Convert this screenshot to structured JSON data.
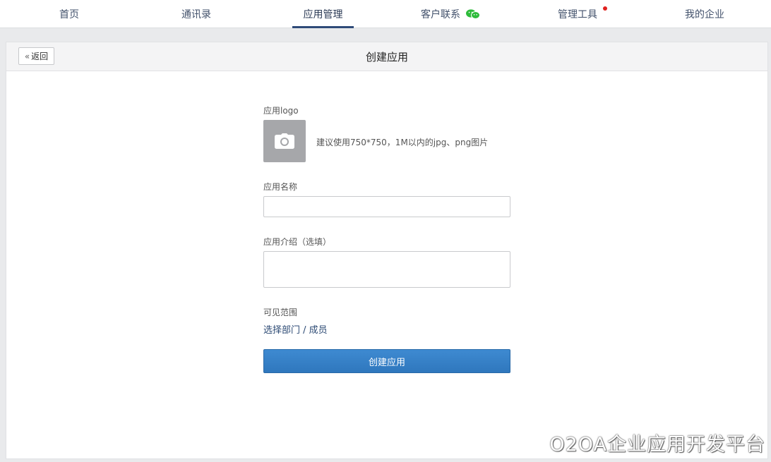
{
  "nav": {
    "items": [
      {
        "label": "首页"
      },
      {
        "label": "通讯录"
      },
      {
        "label": "应用管理",
        "active": true
      },
      {
        "label": "客户联系",
        "icon": "wechat-icon"
      },
      {
        "label": "管理工具",
        "badge": "red-dot"
      },
      {
        "label": "我的企业"
      }
    ]
  },
  "header": {
    "back_label": "返回",
    "title": "创建应用"
  },
  "form": {
    "logo_label": "应用logo",
    "logo_icon": "camera-icon",
    "logo_hint": "建议使用750*750，1M以内的jpg、png图片",
    "name_label": "应用名称",
    "name_value": "",
    "intro_label": "应用介绍（选填）",
    "intro_value": "",
    "scope_label": "可见范围",
    "scope_link": "选择部门 / 成员",
    "submit_label": "创建应用"
  },
  "watermark": "O2OA企业应用开发平台",
  "colors": {
    "accent": "#2f77bd",
    "nav_active_underline": "#2f4a78",
    "badge_red": "#e0211f",
    "wechat_green": "#2dbb3a"
  }
}
